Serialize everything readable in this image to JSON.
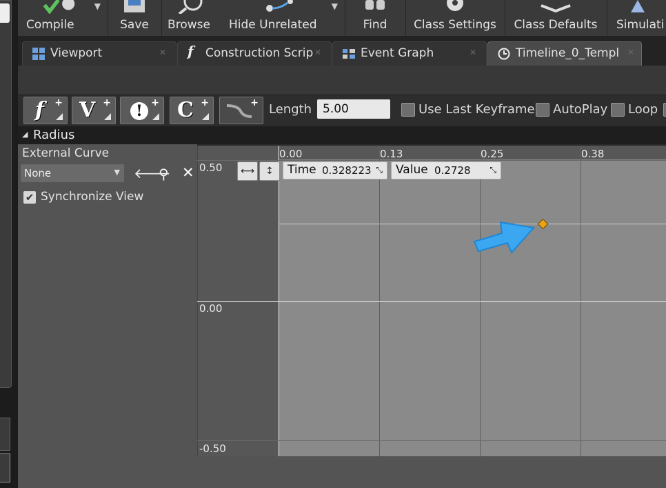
{
  "toolbar": {
    "items": [
      {
        "label": "Compile"
      },
      {
        "label": "Save"
      },
      {
        "label": "Browse"
      },
      {
        "label": "Hide Unrelated"
      },
      {
        "label": "Find"
      },
      {
        "label": "Class Settings"
      },
      {
        "label": "Class Defaults"
      },
      {
        "label": "Simulati"
      }
    ]
  },
  "tabs": [
    {
      "label": "Viewport"
    },
    {
      "label": "Construction Scrip"
    },
    {
      "label": "Event Graph"
    },
    {
      "label": "Timeline_0_Templ"
    }
  ],
  "timeline": {
    "buttons": [
      "f",
      "V",
      "!",
      "C"
    ],
    "length_label": "Length",
    "length_value": "5.00",
    "use_last_keyframe_label": "Use Last Keyframe?",
    "autoplay_label": "AutoPlay",
    "loop_label": "Loop",
    "track_name": "Radius"
  },
  "props": {
    "external_curve_label": "External Curve",
    "curve_value": "None",
    "sync_view_label": "Synchronize View"
  },
  "graph": {
    "x_ticks": [
      "0.00",
      "0.13",
      "0.25",
      "0.38"
    ],
    "y_ticks": [
      "0.50",
      "0.00",
      "-0.50"
    ],
    "time_label": "Time",
    "time_value": "0.328223",
    "value_label": "Value",
    "value_value": "0.2728"
  },
  "colors": {
    "key": "#e8a317",
    "arrow": "#3aa7f0"
  }
}
